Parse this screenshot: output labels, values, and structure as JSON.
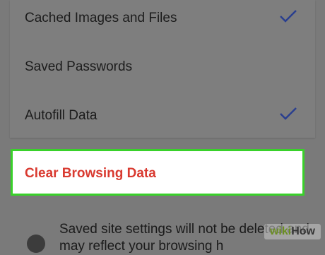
{
  "items": [
    {
      "label": "Cached Images and Files",
      "checked": true
    },
    {
      "label": "Saved Passwords",
      "checked": false
    },
    {
      "label": "Autofill Data",
      "checked": true
    }
  ],
  "clear_button": {
    "label": "Clear Browsing Data"
  },
  "info": {
    "text": "Saved site settings will not be deleted and may reflect your browsing h"
  },
  "watermark": {
    "wiki": "wiki",
    "how": "How"
  },
  "colors": {
    "check": "#2a3f8f",
    "danger": "#d93a30",
    "highlight": "#39d12a"
  }
}
